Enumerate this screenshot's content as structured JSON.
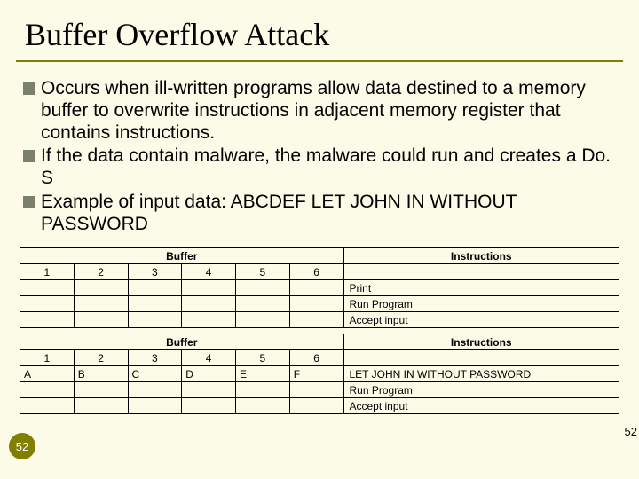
{
  "title": "Buffer Overflow Attack",
  "bullets": [
    "Occurs when ill-written programs allow data destined to a memory buffer to overwrite instructions in adjacent memory register that contains instructions.",
    "If the data contain malware, the malware could run and creates a Do. S",
    "Example of input data: ABCDEF LET JOHN IN WITHOUT PASSWORD"
  ],
  "table1": {
    "buffer_header": "Buffer",
    "instr_header": "Instructions",
    "cols": [
      "1",
      "2",
      "3",
      "4",
      "5",
      "6"
    ],
    "rowA": [
      "",
      "",
      "",
      "",
      "",
      ""
    ],
    "instrA": "Print",
    "rowB": [
      "",
      "",
      "",
      "",
      "",
      ""
    ],
    "instrB": "Run Program",
    "rowC": [
      "",
      "",
      "",
      "",
      "",
      ""
    ],
    "instrC": "Accept input"
  },
  "table2": {
    "buffer_header": "Buffer",
    "instr_header": "Instructions",
    "cols": [
      "1",
      "2",
      "3",
      "4",
      "5",
      "6"
    ],
    "rowA": [
      "A",
      "B",
      "C",
      "D",
      "E",
      "F"
    ],
    "instrA": "LET JOHN IN WITHOUT PASSWORD",
    "rowB": [
      "",
      "",
      "",
      "",
      "",
      ""
    ],
    "instrB": "Run Program",
    "rowC": [
      "",
      "",
      "",
      "",
      "",
      ""
    ],
    "instrC": "Accept input"
  },
  "page": {
    "badge": "52",
    "right": "52"
  }
}
